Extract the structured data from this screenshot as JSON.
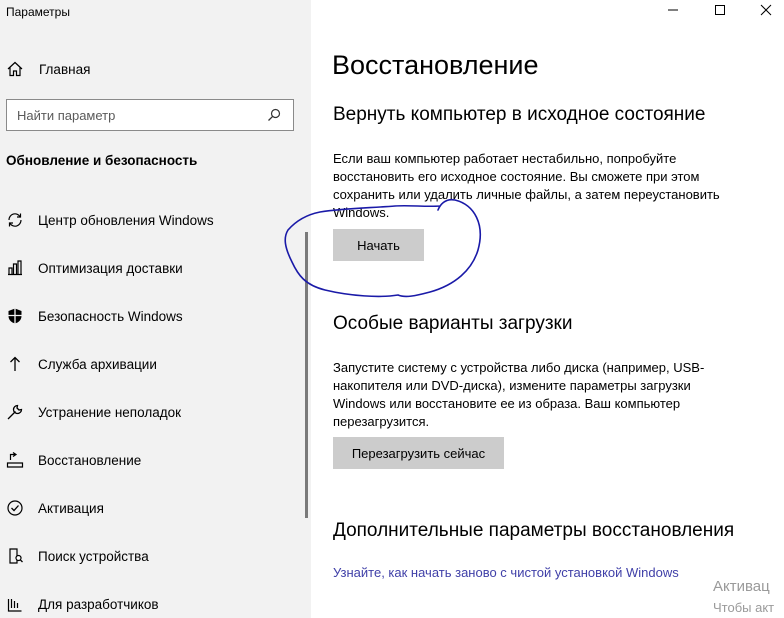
{
  "window": {
    "title": "Параметры",
    "controls": [
      {
        "name": "minimize",
        "glyph": "minimize-icon"
      },
      {
        "name": "maximize",
        "glyph": "maximize-icon"
      },
      {
        "name": "close",
        "glyph": "close-icon"
      }
    ]
  },
  "sidebar": {
    "home_label": "Главная",
    "search_placeholder": "Найти параметр",
    "section_title": "Обновление и безопасность",
    "items": [
      {
        "label": "Центр обновления Windows",
        "icon": "sync-icon"
      },
      {
        "label": "Оптимизация доставки",
        "icon": "delivery-icon"
      },
      {
        "label": "Безопасность Windows",
        "icon": "shield-icon"
      },
      {
        "label": "Служба архивации",
        "icon": "backup-arrow-icon"
      },
      {
        "label": "Устранение неполадок",
        "icon": "wrench-icon"
      },
      {
        "label": "Восстановление",
        "icon": "recovery-icon"
      },
      {
        "label": "Активация",
        "icon": "activation-check-icon"
      },
      {
        "label": "Поиск устройства",
        "icon": "find-device-icon"
      },
      {
        "label": "Для разработчиков",
        "icon": "developer-icon"
      }
    ]
  },
  "main": {
    "page_title": "Восстановление",
    "reset": {
      "heading": "Вернуть компьютер в исходное состояние",
      "description": "Если ваш компьютер работает нестабильно, попробуйте восстановить его исходное состояние. Вы сможете при этом сохранить или удалить личные файлы, а затем переустановить Windows.",
      "button": "Начать"
    },
    "advanced_startup": {
      "heading": "Особые варианты загрузки",
      "description": "Запустите систему с устройства либо диска (например, USB-накопителя или DVD-диска), измените параметры загрузки Windows или восстановите ее из образа. Ваш компьютер перезагрузится.",
      "button": "Перезагрузить сейчас"
    },
    "more": {
      "heading": "Дополнительные параметры восстановления",
      "link": "Узнайте, как начать заново с чистой установкой Windows"
    },
    "watermark": {
      "line1": "Активац",
      "line2": "Чтобы акт"
    }
  },
  "colors": {
    "sidebar_bg": "#f2f2f2",
    "button_bg": "#cccccc",
    "link": "#4040a8",
    "annotation": "#1a1aa8"
  }
}
